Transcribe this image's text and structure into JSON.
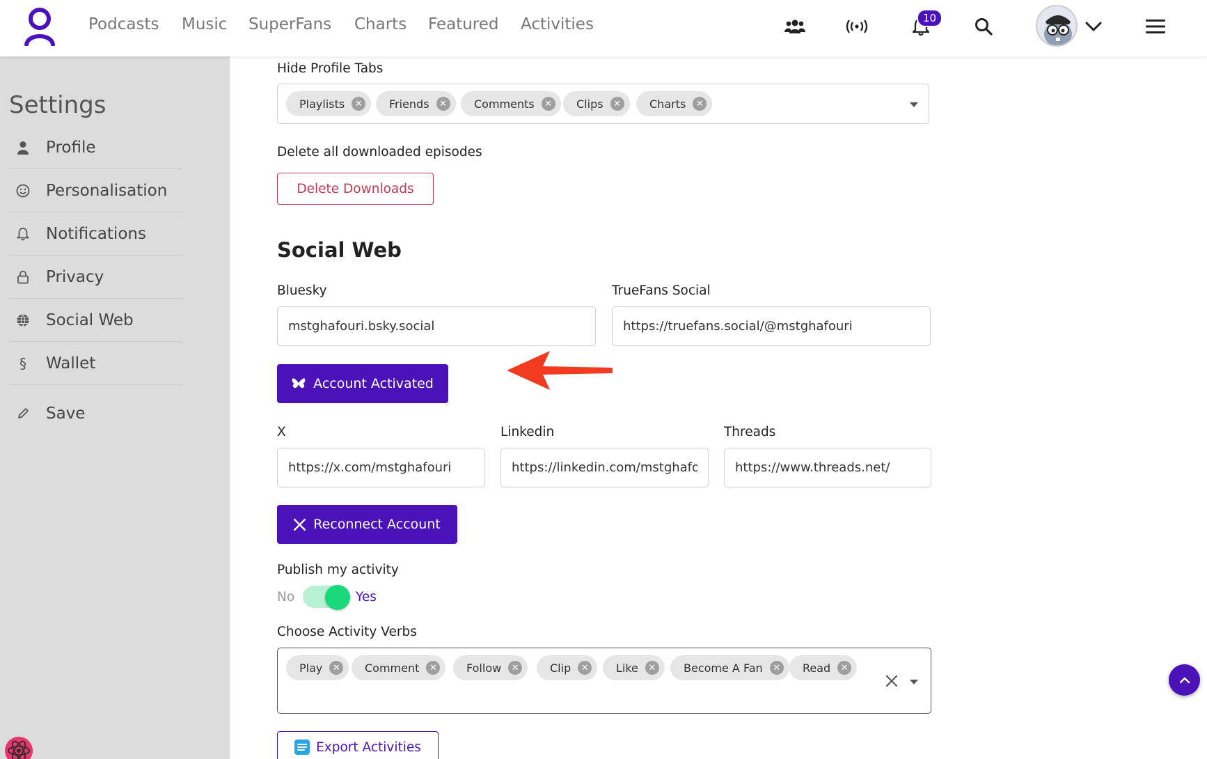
{
  "nav": {
    "links": [
      "Podcasts",
      "Music",
      "SuperFans",
      "Charts",
      "Featured",
      "Activities"
    ],
    "notification_count": "10",
    "icons": [
      "users-icon",
      "live-broadcast-icon",
      "bell-icon",
      "search-icon",
      "avatar",
      "chevron-down-icon",
      "hamburger-menu-icon"
    ]
  },
  "sidebar": {
    "title": "Settings",
    "items": [
      {
        "label": "Profile",
        "icon": "user-icon"
      },
      {
        "label": "Personalisation",
        "icon": "smiley-icon"
      },
      {
        "label": "Notifications",
        "icon": "bell-icon"
      },
      {
        "label": "Privacy",
        "icon": "lock-icon"
      },
      {
        "label": "Social Web",
        "icon": "globe-icon"
      },
      {
        "label": "Wallet",
        "icon": "section-sign-icon"
      },
      {
        "label": "Save",
        "icon": "pencil-icon"
      }
    ]
  },
  "main": {
    "hide_tabs_label": "Hide Profile Tabs",
    "hide_tabs": [
      "Playlists",
      "Friends",
      "Comments",
      "Clips",
      "Charts"
    ],
    "delete_label": "Delete all downloaded episodes",
    "delete_button": "Delete Downloads",
    "social_heading": "Social Web",
    "bluesky_label": "Bluesky",
    "bluesky_value": "mstghafouri.bsky.social",
    "truefans_label": "TrueFans Social",
    "truefans_value": "https://truefans.social/@mstghafouri",
    "account_activated_button": "Account Activated",
    "x_label": "X",
    "x_value": "https://x.com/mstghafouri",
    "linkedin_label": "Linkedin",
    "linkedin_value": "https://linkedin.com/mstghafouri",
    "threads_label": "Threads",
    "threads_value": "https://www.threads.net/",
    "reconnect_button": "Reconnect Account",
    "publish_label": "Publish my activity",
    "toggle_no": "No",
    "toggle_yes": "Yes",
    "verbs_label": "Choose Activity Verbs",
    "verbs": [
      "Play",
      "Comment",
      "Follow",
      "Clip",
      "Like",
      "Become A Fan",
      "Read"
    ],
    "export_button": "Export Activities"
  },
  "colors": {
    "accent": "#4a12b8",
    "danger": "#c23b52",
    "toggle_on": "#19d97a",
    "arrow": "#f23b1e"
  }
}
